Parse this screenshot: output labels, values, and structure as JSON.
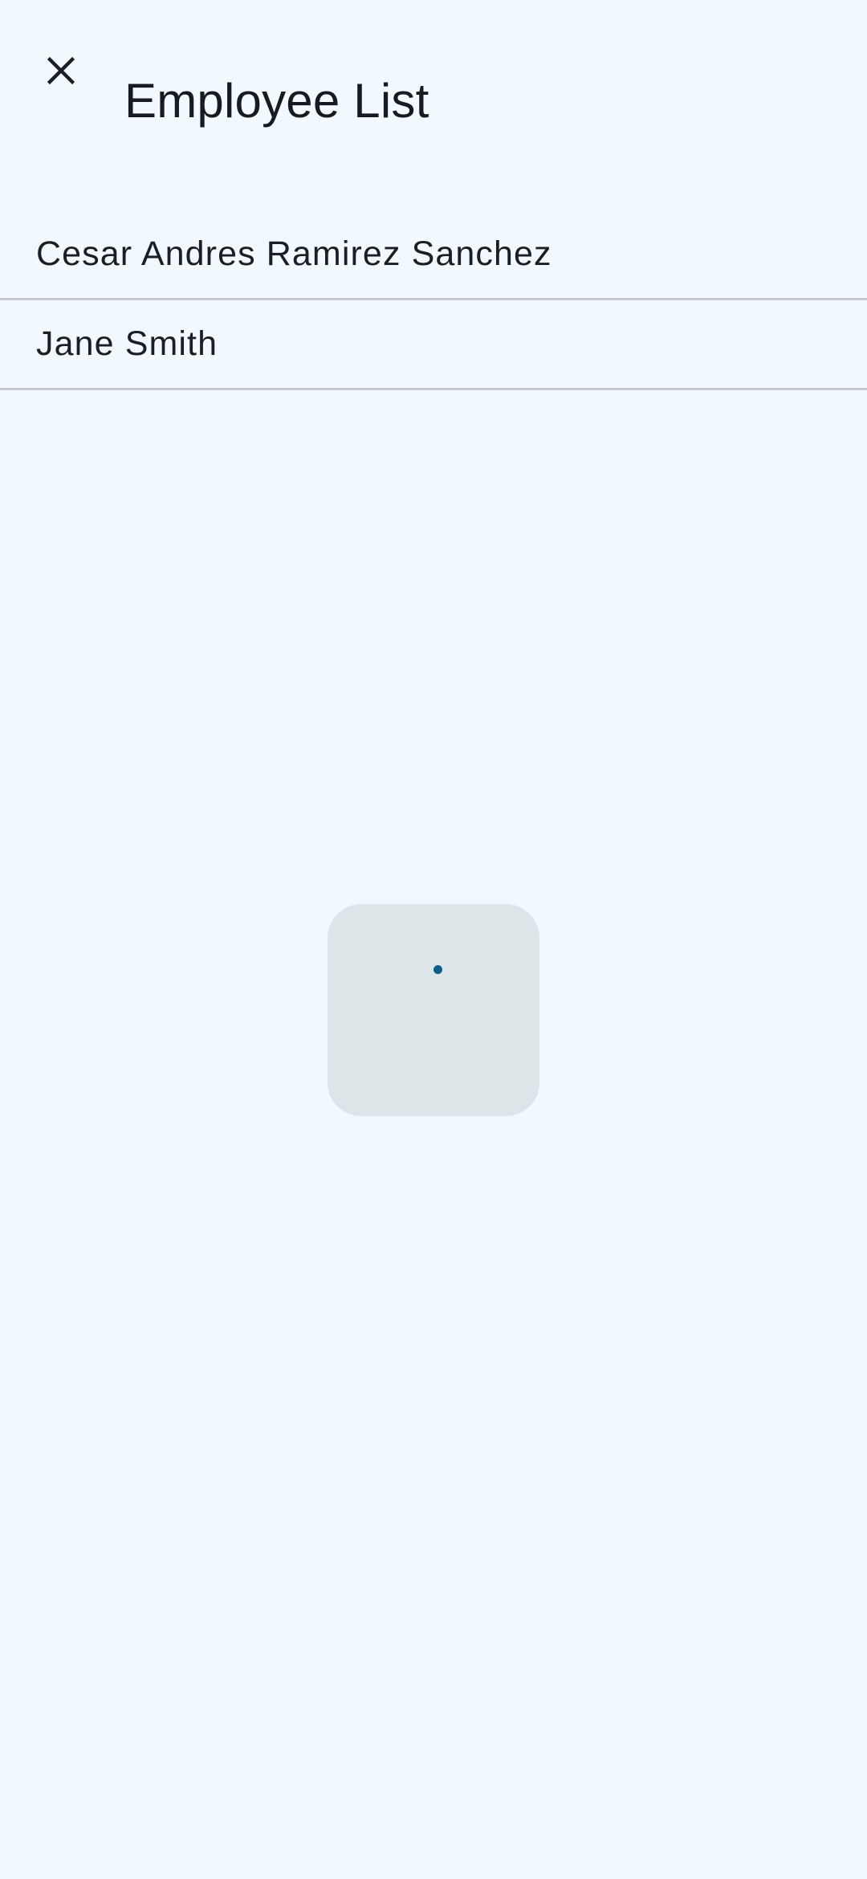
{
  "header": {
    "title": "Employee List",
    "close_icon": "close-icon"
  },
  "employees": [
    {
      "name": "Cesar Andres Ramirez Sanchez"
    },
    {
      "name": "Jane Smith"
    }
  ],
  "loading_dialog": {
    "state": "loading",
    "indicator_color": "#0b5f86"
  },
  "colors": {
    "background": "#f2f9fe",
    "divider": "#c4cacf",
    "dialog_surface": "#dde5e9",
    "text_primary": "#1b1f23"
  }
}
